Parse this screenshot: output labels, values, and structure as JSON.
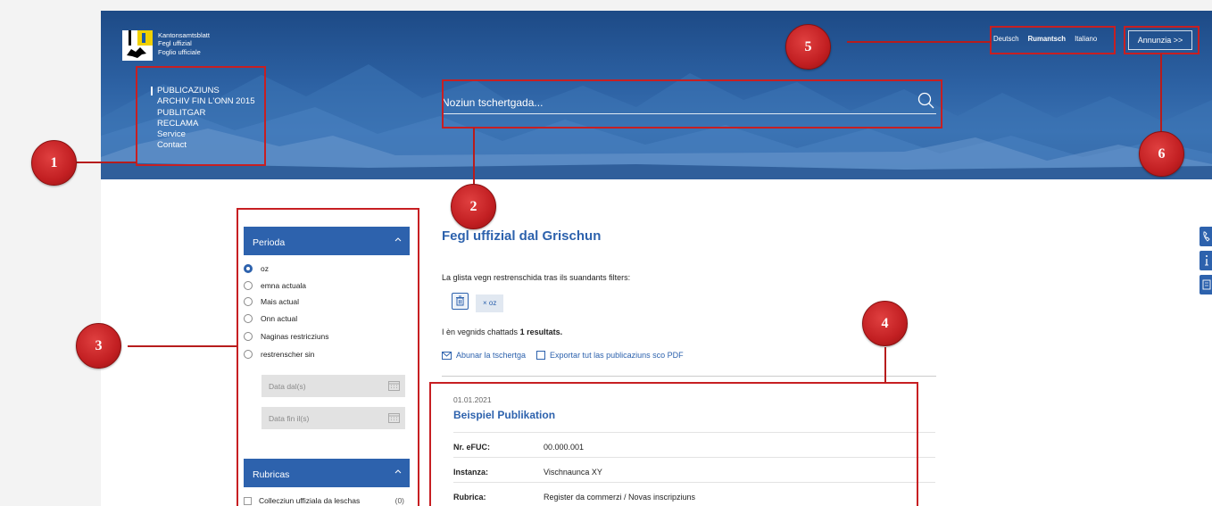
{
  "header": {
    "logo_lines": [
      "Kantonsamtsblatt",
      "Fegl uffizial",
      "Foglio ufficiale"
    ],
    "nav": [
      "PUBLICAZIUNS",
      "ARCHIV FIN L'ONN 2015",
      "PUBLITGAR",
      "RECLAMA",
      "Service",
      "Contact"
    ],
    "search_placeholder": "Noziun tschertgada...",
    "languages": [
      "Deutsch",
      "Rumantsch",
      "Italiano"
    ],
    "current_language": "Rumantsch",
    "cta_label": "Annunzia",
    "cta_arrows": ">>"
  },
  "filters": {
    "period_title": "Perioda",
    "period_options": [
      "oz",
      "emna actuala",
      "Mais actual",
      "Onn actual",
      "Naginas restricziuns",
      "restrenscher sin"
    ],
    "selected_period": "oz",
    "date_from_placeholder": "Data dal(s)",
    "date_to_placeholder": "Data fin il(s)",
    "rubric_title": "Rubricas",
    "rubric_item": {
      "label": "Collecziun uffiziala da leschas",
      "count": "(0)"
    }
  },
  "content": {
    "title": "Fegl uffizial dal Grischun",
    "filter_intro": "La glista vegn restrenschida tras ils suandants filters:",
    "chip_remove": "×",
    "chip_label": "oz",
    "result_prefix": "I èn vegnids chattads",
    "result_count": "1 resultats.",
    "action_subscribe": "Abunar la tschertga",
    "action_export": "Exportar tut las publicaziuns sco PDF"
  },
  "publication": {
    "date": "01.01.2021",
    "title": "Beispiel Publikation",
    "rows": [
      {
        "key": "Nr. eFUC:",
        "value": "00.000.001"
      },
      {
        "key": "Instanza:",
        "value": "Vischnaunca XY"
      },
      {
        "key": "Rubrica:",
        "value": "Register da commerzi / Novas inscripziuns"
      }
    ]
  },
  "annotations": [
    "1",
    "2",
    "3",
    "4",
    "5",
    "6"
  ],
  "colors": {
    "accent": "#2d62ad",
    "annotation": "#c71f22",
    "hero": "#2a5a9a"
  }
}
